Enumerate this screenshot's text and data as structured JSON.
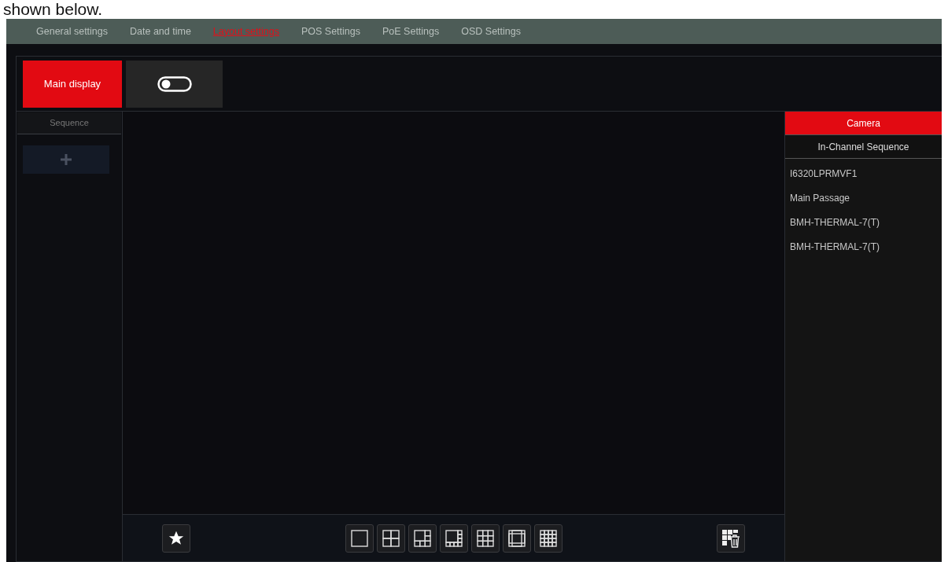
{
  "caption": "shown below.",
  "tabs": [
    {
      "label": "General settings",
      "selected": false
    },
    {
      "label": "Date and time",
      "selected": false
    },
    {
      "label": "Layout settings",
      "selected": true
    },
    {
      "label": "POS Settings",
      "selected": false
    },
    {
      "label": "PoE Settings",
      "selected": false
    },
    {
      "label": "OSD Settings",
      "selected": false
    }
  ],
  "display": {
    "label": "Main display",
    "selected": true
  },
  "toggle": {
    "on": false
  },
  "sequence": {
    "title": "Sequence"
  },
  "source_tabs": [
    {
      "label": "Camera",
      "selected": true
    },
    {
      "label": "In-Channel Sequence",
      "selected": false
    }
  ],
  "cameras": [
    "I6320LPRMVF1",
    "Main Passage",
    "BMH-THERMAL-7(T)",
    "BMH-THERMAL-7(T)"
  ],
  "layouts": [
    {
      "kind": "single"
    },
    {
      "kind": "quad"
    },
    {
      "kind": "six"
    },
    {
      "kind": "eight"
    },
    {
      "kind": "nine"
    },
    {
      "kind": "thirteen"
    },
    {
      "kind": "sixteen"
    }
  ]
}
